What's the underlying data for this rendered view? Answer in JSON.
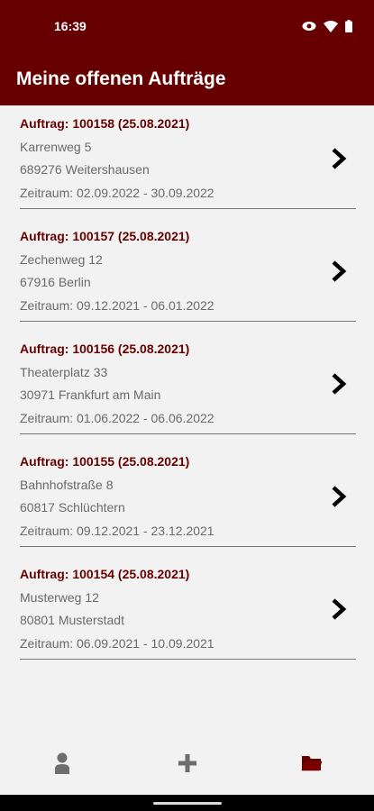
{
  "status": {
    "time": "16:39"
  },
  "app": {
    "title": "Meine offenen Aufträge"
  },
  "orders": [
    {
      "title": "Auftrag: 100158 (25.08.2021)",
      "street": "Karrenweg 5",
      "city": "689276 Weitershausen",
      "period": "Zeitraum: 02.09.2022 - 30.09.2022"
    },
    {
      "title": "Auftrag: 100157 (25.08.2021)",
      "street": "Zechenweg 12",
      "city": "67916 Berlin",
      "period": "Zeitraum: 09.12.2021 - 06.01.2022"
    },
    {
      "title": "Auftrag: 100156 (25.08.2021)",
      "street": "Theaterplatz 33",
      "city": "30971 Frankfurt am Main",
      "period": "Zeitraum: 01.06.2022 - 06.06.2022"
    },
    {
      "title": "Auftrag: 100155 (25.08.2021)",
      "street": "Bahnhofstraße 8",
      "city": "60817 Schlüchtern",
      "period": "Zeitraum: 09.12.2021 - 23.12.2021"
    },
    {
      "title": "Auftrag: 100154 (25.08.2021)",
      "street": "Musterweg 12",
      "city": "80801 Musterstadt",
      "period": "Zeitraum: 06.09.2021 - 10.09.2021"
    }
  ],
  "nav": {
    "items": [
      {
        "icon": "person-icon",
        "active": false
      },
      {
        "icon": "plus-icon",
        "active": false
      },
      {
        "icon": "folder-icon",
        "active": true
      }
    ]
  },
  "colors": {
    "primary": "#660000",
    "background": "#f2f2f2",
    "icon_inactive": "#6e6e6e"
  }
}
